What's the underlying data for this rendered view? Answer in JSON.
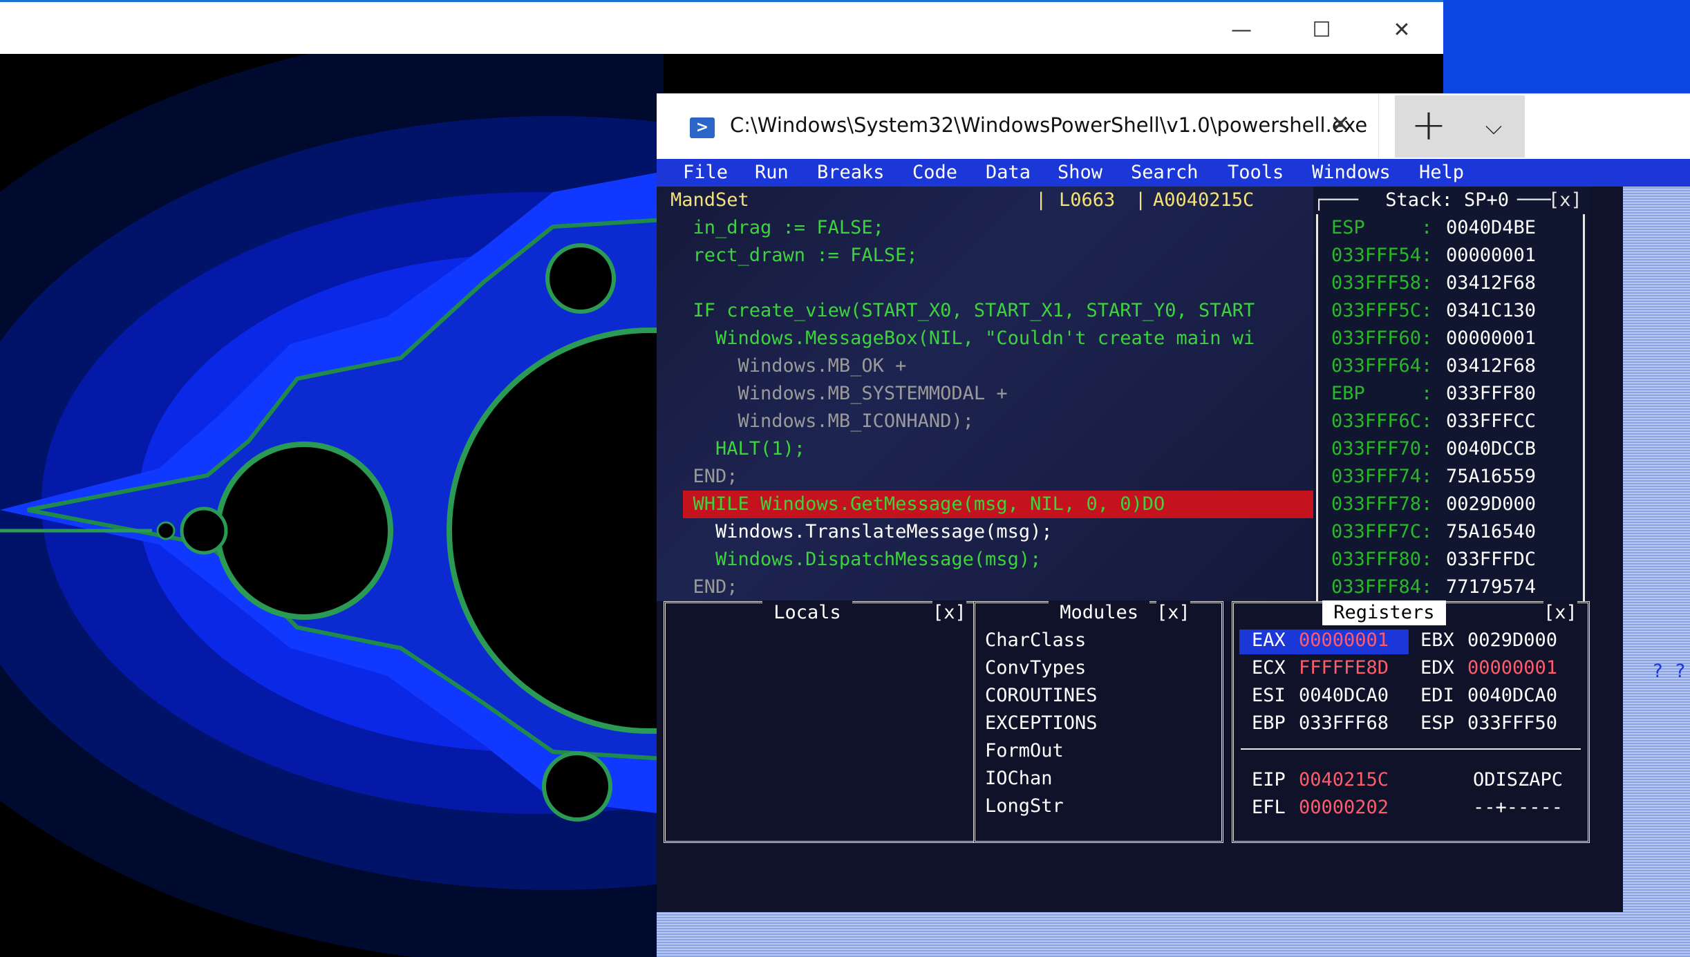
{
  "host_window": {
    "minimize_glyph": "—",
    "maximize_glyph": "☐",
    "close_glyph": "✕"
  },
  "terminal": {
    "tab_title": "C:\\Windows\\System32\\WindowsPowerShell\\v1.0\\powershell.exe",
    "tab_close_glyph": "✕",
    "new_tab_glyph": "+",
    "dropdown_glyph": "⌵"
  },
  "menu": [
    "File",
    "Run",
    "Breaks",
    "Code",
    "Data",
    "Show",
    "Search",
    "Tools",
    "Windows",
    "Help"
  ],
  "code": {
    "module": "MandSet",
    "line": "L0663",
    "address": "A0040215C",
    "lines": [
      {
        "text": "  in_drag := FALSE;",
        "color": "#3ed33e"
      },
      {
        "text": "  rect_drawn := FALSE;",
        "color": "#3ed33e"
      },
      {
        "text": "",
        "color": "#3ed33e"
      },
      {
        "text": "  IF create_view(START_X0, START_X1, START_Y0, START",
        "color": "#3ed33e"
      },
      {
        "text": "    Windows.MessageBox(NIL, \"Couldn't create main wi",
        "color": "#3ed33e"
      },
      {
        "text": "      Windows.MB_OK +",
        "color": "#9a9a9a"
      },
      {
        "text": "      Windows.MB_SYSTEMMODAL +",
        "color": "#9a9a9a"
      },
      {
        "text": "      Windows.MB_ICONHAND);",
        "color": "#9a9a9a"
      },
      {
        "text": "    HALT(1);",
        "color": "#3ed33e"
      },
      {
        "text": "  END;",
        "color": "#9a9a9a"
      },
      {
        "text": "  WHILE Windows.GetMessage(msg, NIL, 0, 0)DO",
        "color": "#3ed33e"
      },
      {
        "text": "    Windows.TranslateMessage(msg);",
        "color": "#ffffff"
      },
      {
        "text": "    Windows.DispatchMessage(msg);",
        "color": "#3ed33e"
      },
      {
        "text": "  END;",
        "color": "#9a9a9a"
      }
    ]
  },
  "stack": {
    "title": " Stack: SP+0 ",
    "close": "[x]",
    "rows": [
      {
        "addr": "ESP     :",
        "val": "0040D4BE"
      },
      {
        "addr": "033FFF54:",
        "val": "00000001"
      },
      {
        "addr": "033FFF58:",
        "val": "03412F68"
      },
      {
        "addr": "033FFF5C:",
        "val": "0341C130"
      },
      {
        "addr": "033FFF60:",
        "val": "00000001"
      },
      {
        "addr": "033FFF64:",
        "val": "03412F68"
      },
      {
        "addr": "EBP     :",
        "val": "033FFF80"
      },
      {
        "addr": "033FFF6C:",
        "val": "033FFFCC"
      },
      {
        "addr": "033FFF70:",
        "val": "0040DCCB"
      },
      {
        "addr": "033FFF74:",
        "val": "75A16559"
      },
      {
        "addr": "033FFF78:",
        "val": "0029D000"
      },
      {
        "addr": "033FFF7C:",
        "val": "75A16540"
      },
      {
        "addr": "033FFF80:",
        "val": "033FFFDC"
      },
      {
        "addr": "033FFF84:",
        "val": "77179574"
      }
    ]
  },
  "locals": {
    "title": " Locals ",
    "close": "[x]"
  },
  "modules": {
    "title": " Modules ",
    "close": "[x]",
    "items": [
      "CharClass",
      "ConvTypes",
      "COROUTINES",
      "EXCEPTIONS",
      "FormOut",
      "IOChan",
      "LongStr"
    ]
  },
  "registers": {
    "title": " Registers ",
    "close": "[x]",
    "rows": [
      {
        "n1": "EAX",
        "v1": "00000001",
        "c1": "#ff5b6b",
        "n2": "EBX",
        "v2": "0029D000",
        "c2": "#ffffff"
      },
      {
        "n1": "ECX",
        "v1": "FFFFFE8D",
        "c1": "#ff5b6b",
        "n2": "EDX",
        "v2": "00000001",
        "c2": "#ff5b6b"
      },
      {
        "n1": "ESI",
        "v1": "0040DCA0",
        "c1": "#ffffff",
        "n2": "EDI",
        "v2": "0040DCA0",
        "c2": "#ffffff"
      },
      {
        "n1": "EBP",
        "v1": "033FFF68",
        "c1": "#ffffff",
        "n2": "ESP",
        "v2": "033FFF50",
        "c2": "#ffffff"
      }
    ],
    "eip_label": "EIP",
    "eip": "0040215C",
    "flags_label": "ODISZAPC",
    "efl_label": "EFL",
    "efl": "00000202",
    "flags": "--+-----"
  },
  "colors": {
    "code_green": "#3ed33e",
    "stack_addr_green": "#29b829",
    "highlight_red": "#c4121f",
    "menubar_blue": "#1b37d8",
    "register_selected": "#1b37d8",
    "header_yellow": "#f3e27a"
  },
  "stray_glyphs": "? ?"
}
